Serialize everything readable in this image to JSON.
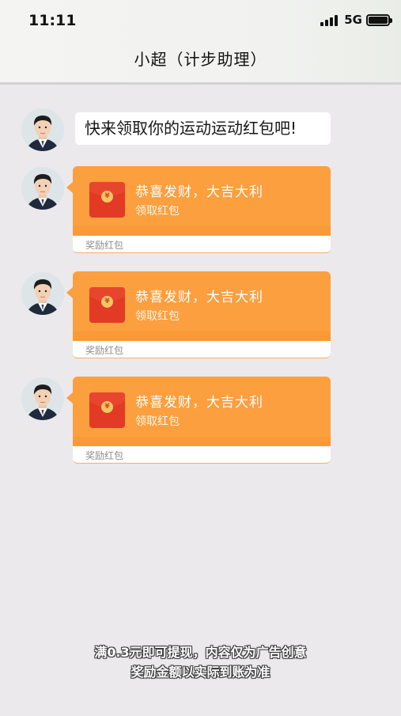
{
  "status_bar": {
    "time": "11:11",
    "network": "5G",
    "signal_icon": "signal-bars-icon",
    "battery_icon": "battery-full-icon"
  },
  "header": {
    "title": "小超（计步助理）"
  },
  "messages": [
    {
      "type": "text",
      "avatar_icon": "assistant-avatar-icon",
      "text": "快来领取你的运动运动红包吧!"
    },
    {
      "type": "red_packet",
      "avatar_icon": "assistant-avatar-icon",
      "envelope_icon": "red-envelope-icon",
      "seal": "¥",
      "wish": "恭喜发财，大吉大利",
      "action": "领取红包",
      "footer": "奖励红包"
    },
    {
      "type": "red_packet",
      "avatar_icon": "assistant-avatar-icon",
      "envelope_icon": "red-envelope-icon",
      "seal": "¥",
      "wish": "恭喜发财，大吉大利",
      "action": "领取红包",
      "footer": "奖励红包"
    },
    {
      "type": "red_packet",
      "avatar_icon": "assistant-avatar-icon",
      "envelope_icon": "red-envelope-icon",
      "seal": "¥",
      "wish": "恭喜发财，大吉大利",
      "action": "领取红包",
      "footer": "奖励红包"
    }
  ],
  "disclaimer": {
    "line1": "满0.3元即可提现，内容仅为广告创意",
    "line2": "奖励金额以实际到账为准"
  },
  "colors": {
    "background": "#ebe9ec",
    "packet_orange": "#fc9f3f",
    "envelope_red": "#e23a25"
  }
}
